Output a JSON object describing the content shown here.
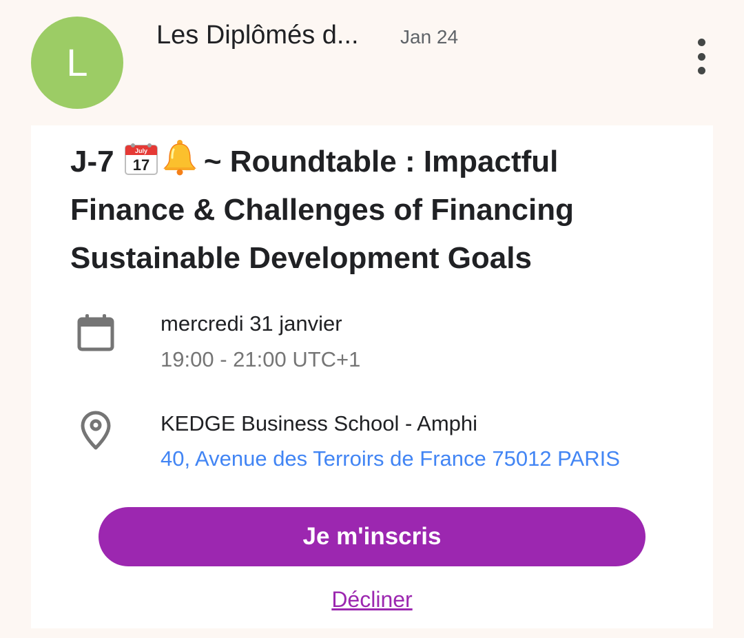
{
  "header": {
    "avatar_letter": "L",
    "sender": "Les Diplômés d...",
    "date": "Jan 24",
    "more_icon": "more-vert-icon"
  },
  "event": {
    "title_prefix": "J-7",
    "title_emoji_1_month": "July",
    "title_emoji_1_day": "17",
    "title_rest": "~ Roundtable : Impactful Finance & Challenges of Financing Sustainable Development Goals",
    "date_line": "mercredi 31 janvier",
    "time_line": "19:00 - 21:00 UTC+1",
    "location_name": "KEDGE Business School - Amphi",
    "address": "40, Avenue des Terroirs de France 75012 PARIS"
  },
  "actions": {
    "rsvp_label": "Je m'inscris",
    "decline_label": "Décliner"
  },
  "colors": {
    "avatar": "#9ccc65",
    "accent": "#9c27b0",
    "link": "#4285f4",
    "background": "#fdf7f3"
  }
}
